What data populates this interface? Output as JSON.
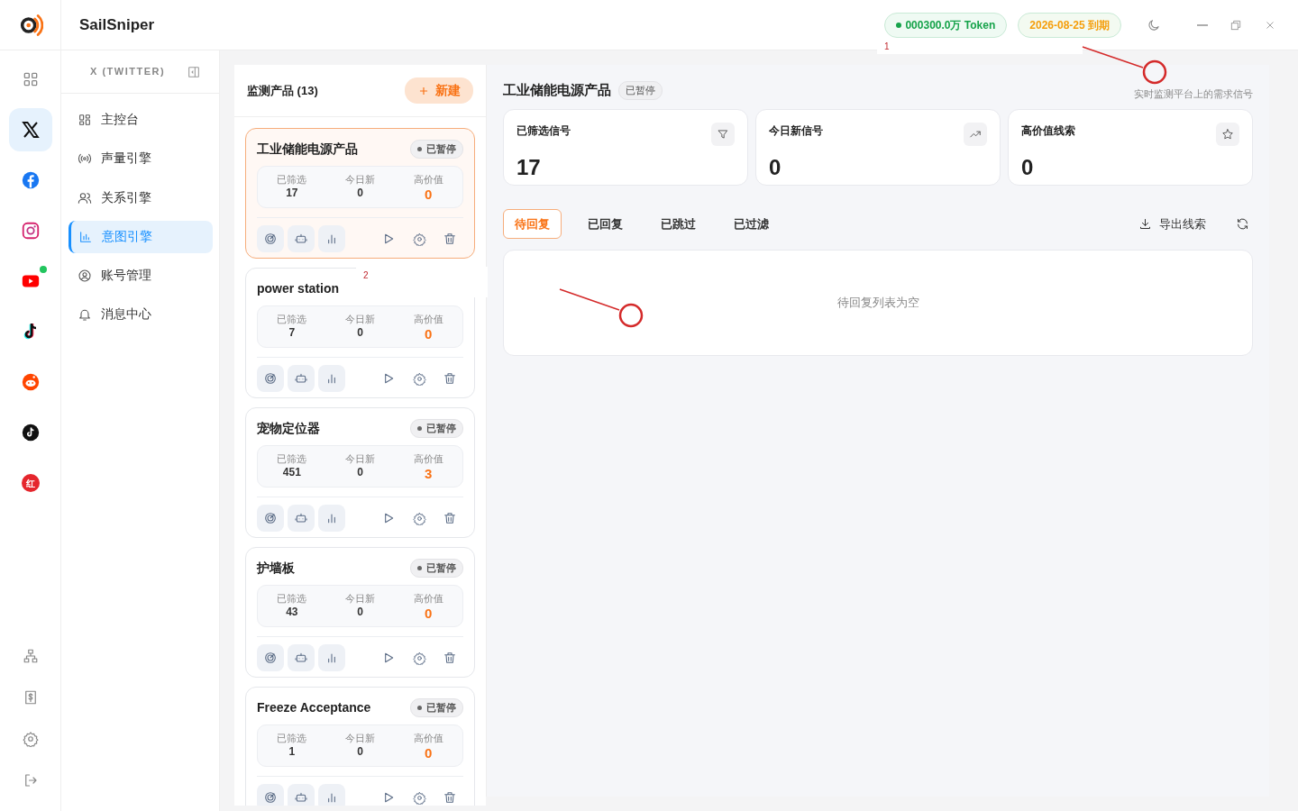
{
  "app": {
    "name": "SailSniper"
  },
  "header": {
    "token_chip": "000300.0万 Token",
    "expiry_chip": "2026-08-25 到期"
  },
  "rail": {
    "top": [
      {
        "kind": "grid",
        "selected": false
      },
      {
        "kind": "x",
        "selected": true
      },
      {
        "kind": "facebook",
        "selected": false
      },
      {
        "kind": "instagram",
        "selected": false
      },
      {
        "kind": "youtube",
        "selected": false,
        "dot": true
      },
      {
        "kind": "tiktok",
        "selected": false
      },
      {
        "kind": "reddit",
        "selected": false
      },
      {
        "kind": "tiktok-round",
        "selected": false
      },
      {
        "kind": "red",
        "selected": false,
        "text": "红"
      }
    ],
    "bottom": [
      {
        "kind": "network"
      },
      {
        "kind": "bill"
      },
      {
        "kind": "settings"
      },
      {
        "kind": "logout"
      }
    ]
  },
  "sidebar": {
    "title": "X (TWITTER)",
    "items": [
      {
        "kind": "dashboard",
        "label": "主控台",
        "selected": false
      },
      {
        "kind": "broadcast",
        "label": "声量引擎",
        "selected": false
      },
      {
        "kind": "users",
        "label": "关系引擎",
        "selected": false
      },
      {
        "kind": "chart",
        "label": "意图引擎",
        "selected": true
      },
      {
        "kind": "account",
        "label": "账号管理",
        "selected": false
      },
      {
        "kind": "bell",
        "label": "消息中心",
        "selected": false
      }
    ]
  },
  "products": {
    "title": "监测产品 (13)",
    "new_button": "新建",
    "items": [
      {
        "name": "工业储能电源产品",
        "status": "已暂停",
        "selected": true,
        "stats": [
          {
            "label": "已筛选",
            "value": "17"
          },
          {
            "label": "今日新",
            "value": "0"
          },
          {
            "label": "高价值",
            "value": "0"
          }
        ]
      },
      {
        "name": "power station",
        "selected": false,
        "stats": [
          {
            "label": "已筛选",
            "value": "7"
          },
          {
            "label": "今日新",
            "value": "0"
          },
          {
            "label": "高价值",
            "value": "0"
          }
        ]
      },
      {
        "name": "宠物定位器",
        "status": "已暂停",
        "selected": false,
        "stats": [
          {
            "label": "已筛选",
            "value": "451"
          },
          {
            "label": "今日新",
            "value": "0"
          },
          {
            "label": "高价值",
            "value": "3"
          }
        ]
      },
      {
        "name": "护墙板",
        "status": "已暂停",
        "selected": false,
        "stats": [
          {
            "label": "已筛选",
            "value": "43"
          },
          {
            "label": "今日新",
            "value": "0"
          },
          {
            "label": "高价值",
            "value": "0"
          }
        ]
      },
      {
        "name": "Freeze Acceptance",
        "status": "已暂停",
        "selected": false,
        "stats": [
          {
            "label": "已筛选",
            "value": "1"
          },
          {
            "label": "今日新",
            "value": "0"
          },
          {
            "label": "高价值",
            "value": "0"
          }
        ]
      }
    ]
  },
  "detail": {
    "title": "工业储能电源产品",
    "status": "已暂停",
    "subtitle": "实时监测平台上的需求信号",
    "stats": [
      {
        "label": "已筛选信号",
        "value": "17",
        "kind": "filter"
      },
      {
        "label": "今日新信号",
        "value": "0",
        "kind": "trend"
      },
      {
        "label": "高价值线索",
        "value": "0",
        "kind": "star"
      }
    ],
    "tabs": [
      {
        "label": "待回复",
        "selected": true
      },
      {
        "label": "已回复",
        "selected": false
      },
      {
        "label": "已跳过",
        "selected": false
      },
      {
        "label": "已过滤",
        "selected": false
      }
    ],
    "export_button": "导出线索",
    "empty_text": "待回复列表为空"
  },
  "guides": [
    {
      "number": "1"
    },
    {
      "number": "2"
    }
  ]
}
